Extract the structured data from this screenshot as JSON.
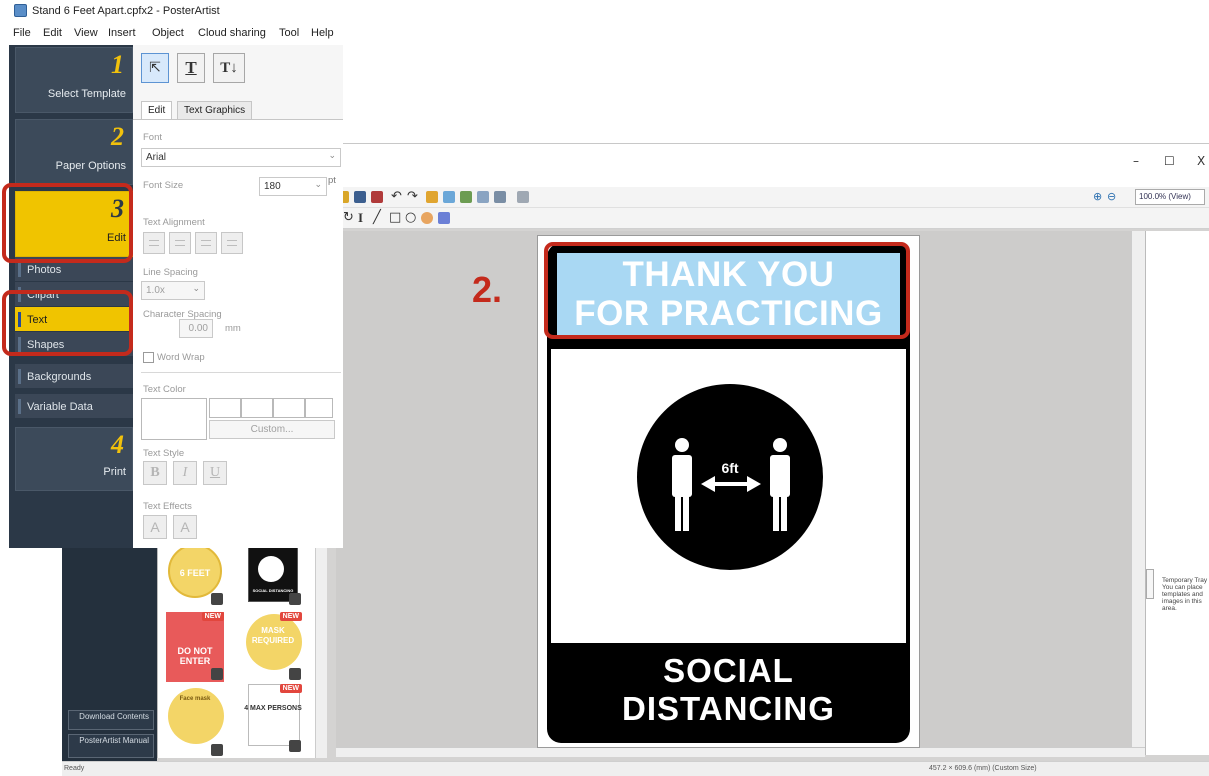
{
  "window": {
    "title": "Stand 6 Feet Apart.cpfx2 - PosterArtist",
    "controls": {
      "minimize": "–",
      "maximize": "☐",
      "close": "X"
    }
  },
  "menu": [
    "File",
    "Edit",
    "View",
    "Insert",
    "Object",
    "Cloud sharing",
    "Tool",
    "Help"
  ],
  "steps": [
    {
      "number": "1",
      "label": "Select Template"
    },
    {
      "number": "2",
      "label": "Paper Options"
    },
    {
      "number": "3",
      "label": "Edit"
    },
    {
      "number": "4",
      "label": "Print"
    }
  ],
  "sub_items": [
    "Photos",
    "Clipart",
    "Text",
    "Shapes",
    "Backgrounds",
    "Variable Data"
  ],
  "side_buttons": {
    "download": "Download Contents",
    "manual": "PosterArtist Manual"
  },
  "panel": {
    "tools": {
      "select": "⇱",
      "text_horizontal": "T",
      "text_vertical": "T↓"
    },
    "tabs": [
      "Edit",
      "Text Graphics"
    ],
    "font_label": "Font",
    "font_value": "Arial",
    "font_size_label": "Font Size",
    "font_size_value": "180",
    "font_size_unit": "pt",
    "alignment_label": "Text Alignment",
    "line_spacing_label": "Line Spacing",
    "line_spacing_value": "1.0x",
    "char_spacing_label": "Character Spacing",
    "char_spacing_value": "0.00",
    "char_spacing_unit": "mm",
    "word_wrap_label": "Word Wrap",
    "text_color_label": "Text Color",
    "custom_label": "Custom...",
    "text_style_label": "Text Style",
    "style_buttons": [
      "B",
      "I",
      "U"
    ],
    "text_effects_label": "Text Effects",
    "effect_buttons": [
      "A",
      "A"
    ]
  },
  "toolbar": {
    "zoom": "100.0% (View)"
  },
  "thumbnails": [
    {
      "label": "6 FEET",
      "badge": ""
    },
    {
      "label": "SOCIAL DISTANCING",
      "badge": ""
    },
    {
      "label": "DO NOT ENTER",
      "badge": "NEW"
    },
    {
      "label": "MASK REQUIRED",
      "badge": "NEW"
    },
    {
      "label": "Face mask",
      "badge": ""
    },
    {
      "label": "4 MAX PERSONS",
      "badge": "NEW"
    }
  ],
  "poster": {
    "line1": "THANK YOU",
    "line2": "FOR PRACTICING",
    "distance": "6ft",
    "bottom1": "SOCIAL",
    "bottom2": "DISTANCING"
  },
  "tray_text": "Temporary Tray You can place templates and images in this area.",
  "status": {
    "left": "Ready",
    "right": "457.2 × 609.6 (mm) (Custom Size)"
  },
  "annotation": "2.",
  "colors": {
    "accent": "#f0c400",
    "sidebar": "#2b3847",
    "banner": "#a9d8f3",
    "highlight": "#c42a1c"
  }
}
